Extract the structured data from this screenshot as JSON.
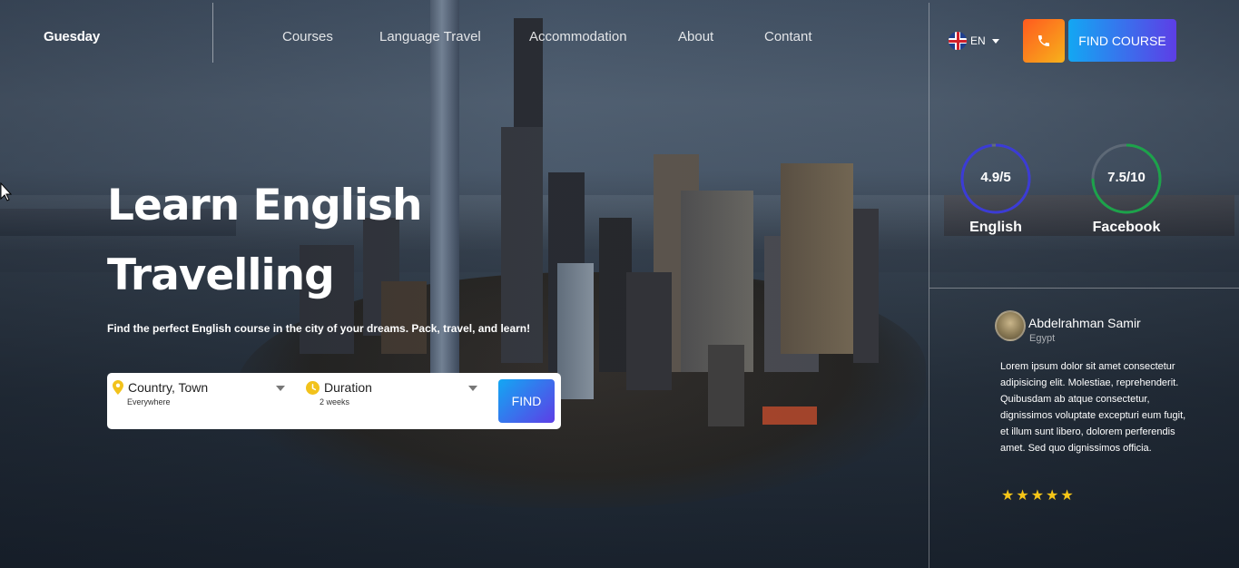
{
  "header": {
    "brand": "Guesday",
    "nav": [
      {
        "label": "Courses"
      },
      {
        "label": "Language Travel"
      },
      {
        "label": "Accommodation"
      },
      {
        "label": "About"
      },
      {
        "label": "Contant"
      }
    ],
    "language": "EN",
    "find_course_label": "FIND COURSE"
  },
  "hero": {
    "title_line1": "Learn English",
    "title_line2": "Travelling",
    "subtitle": "Find the perfect English course in the city of your dreams. Pack, travel, and learn!"
  },
  "search": {
    "location_label": "Country, Town",
    "location_value": "Everywhere",
    "duration_label": "Duration",
    "duration_value": "2 weeks",
    "find_label": "FIND"
  },
  "ratings": [
    {
      "value": "4.9/5",
      "name": "English",
      "fraction": 0.98,
      "color": "#3b3bd6"
    },
    {
      "value": "7.5/10",
      "name": "Facebook",
      "fraction": 0.75,
      "color": "#1ca34a"
    }
  ],
  "testimonial": {
    "author": "Abdelrahman Samir",
    "country": "Egypt",
    "text": "Lorem ipsum dolor sit amet consectetur adipisicing elit. Molestiae, reprehenderit. Quibusdam ab atque consectetur, dignissimos voluptate excepturi eum fugit, et illum sunt libero, dolorem perferendis amet. Sed quo dignissimos officia.",
    "stars": 5
  },
  "colors": {
    "accent_gradient_start": "#13a7f3",
    "accent_gradient_end": "#5d3ee6",
    "phone_gradient_start": "#ff5a1f",
    "phone_gradient_end": "#f7b21b",
    "star": "#f5c518",
    "pin": "#f2c21b"
  }
}
